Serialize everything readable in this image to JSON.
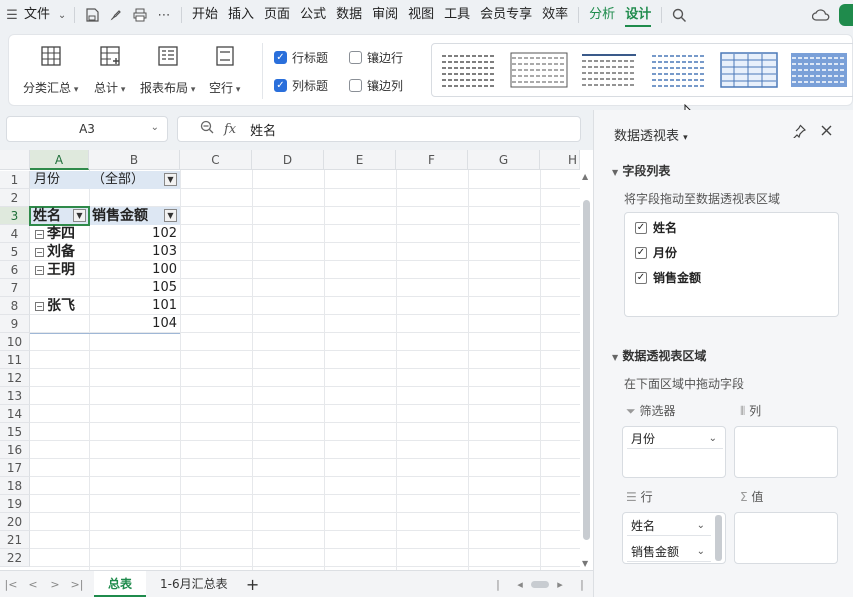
{
  "menu": {
    "file": "文件",
    "tabs": [
      "开始",
      "插入",
      "页面",
      "公式",
      "数据",
      "审阅",
      "视图",
      "工具",
      "会员专享",
      "效率"
    ],
    "analyze": "分析",
    "design": "设计"
  },
  "ribbon": {
    "subtotal": "分类汇总",
    "grand_total": "总计",
    "report_layout": "报表布局",
    "blank_rows": "空行",
    "row_headers": "行标题",
    "col_headers": "列标题",
    "banded_rows": "镶边行",
    "banded_cols": "镶边列",
    "row_headers_checked": true,
    "col_headers_checked": true,
    "banded_rows_checked": false,
    "banded_cols_checked": false
  },
  "namebox": {
    "value": "A3"
  },
  "formula": {
    "fx": "fx",
    "value": "姓名"
  },
  "columns": [
    "A",
    "B",
    "C",
    "D",
    "E",
    "F",
    "G",
    "H"
  ],
  "rows": [
    "1",
    "2",
    "3",
    "4",
    "5",
    "6",
    "7",
    "8",
    "9",
    "10",
    "11",
    "12",
    "13",
    "14",
    "15",
    "16",
    "17",
    "18",
    "19",
    "20",
    "21",
    "22"
  ],
  "cells": {
    "a1": "月份",
    "b1": "（全部）",
    "a3": "姓名",
    "b3": "销售金额",
    "a4": "李四",
    "b4": "102",
    "a5": "刘备",
    "b5": "103",
    "a6": "王明",
    "b6": "100",
    "b7": "105",
    "a8": "张飞",
    "b8": "101",
    "b9": "104"
  },
  "sheet_tabs": [
    "总表",
    "1-6月汇总表"
  ],
  "panel": {
    "title": "数据透视表",
    "field_list_title": "字段列表",
    "field_list_hint": "将字段拖动至数据透视表区域",
    "fields": [
      "姓名",
      "月份",
      "销售金额"
    ],
    "areas_title": "数据透视表区域",
    "areas_hint": "在下面区域中拖动字段",
    "filter_label": "筛选器",
    "column_label": "列",
    "row_label": "行",
    "value_label": "值",
    "filter_items": [
      "月份"
    ],
    "row_items": [
      "姓名",
      "销售金额"
    ]
  },
  "colors": {
    "accent": "#1f8b4c",
    "check": "#2a6fdb",
    "pivot_header": "#dde7f3"
  }
}
